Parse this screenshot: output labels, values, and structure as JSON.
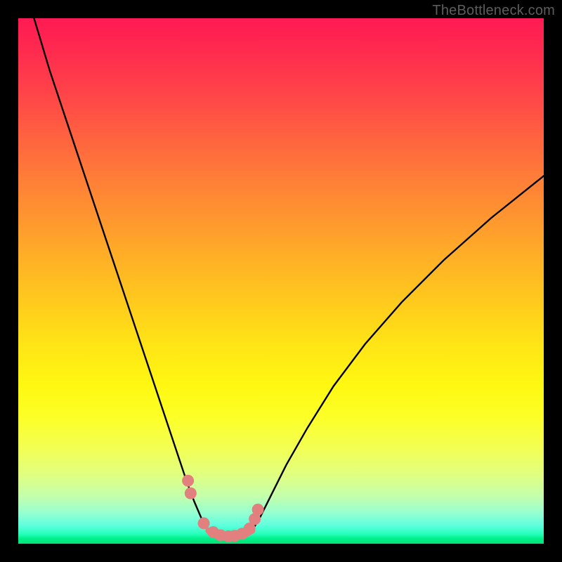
{
  "watermark": "TheBottleneck.com",
  "chart_data": {
    "type": "line",
    "title": "",
    "xlabel": "",
    "ylabel": "",
    "xlim": [
      0,
      100
    ],
    "ylim": [
      0,
      100
    ],
    "grid": false,
    "series": [
      {
        "name": "curve-left",
        "x": [
          3,
          6,
          10,
          14,
          18,
          22,
          25,
          28,
          30,
          32,
          33.5,
          35,
          36.2
        ],
        "y": [
          100,
          90,
          78,
          66,
          54,
          42,
          33,
          24,
          18,
          12,
          8,
          4.5,
          2.5
        ]
      },
      {
        "name": "curve-right",
        "x": [
          44.5,
          46,
          48,
          51,
          55,
          60,
          66,
          73,
          81,
          90,
          100
        ],
        "y": [
          2.5,
          5,
          9,
          15,
          22,
          30,
          38,
          46,
          54,
          62,
          70
        ]
      },
      {
        "name": "flat-bottom",
        "x": [
          36.2,
          37.5,
          39,
          40.5,
          42,
          43.3,
          44.5
        ],
        "y": [
          2.5,
          1.6,
          1.3,
          1.3,
          1.4,
          1.8,
          2.5
        ]
      }
    ],
    "scatter": {
      "name": "markers",
      "x": [
        32.3,
        32.8,
        35.3,
        37.1,
        38.5,
        40.0,
        41.2,
        42.6,
        44.0,
        45.0,
        45.6
      ],
      "y": [
        12.0,
        9.6,
        3.9,
        2.2,
        1.6,
        1.4,
        1.5,
        1.9,
        2.9,
        4.7,
        6.5
      ]
    },
    "colors": {
      "curve_stroke": "#000000",
      "marker_fill": "#e28080",
      "gradient_top": "#ff1a53",
      "gradient_bottom": "#00e274",
      "frame": "#000000"
    }
  }
}
